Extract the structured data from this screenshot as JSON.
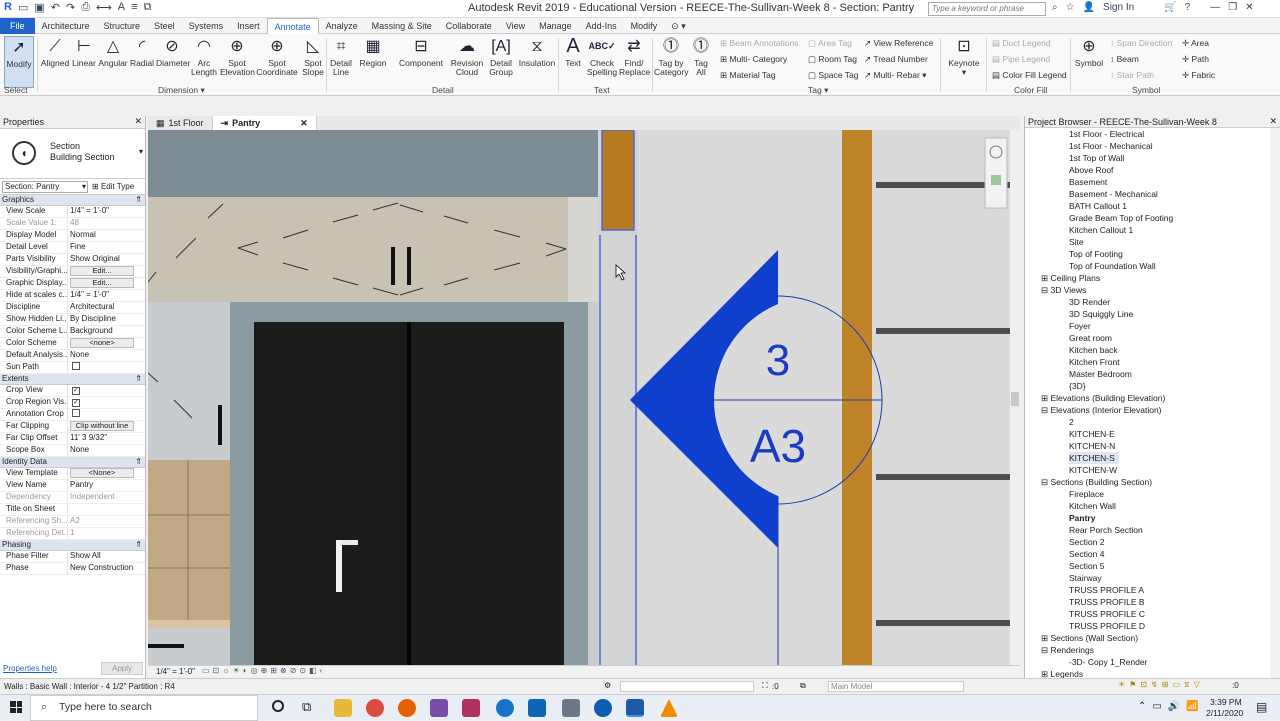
{
  "window": {
    "title": "Autodesk Revit 2019 - Educational Version - REECE-The-Sullivan-Week 8 - Section: Pantry",
    "search_placeholder": "Type a keyword or phrase",
    "sign_in": "Sign In"
  },
  "tabs": [
    "File",
    "Architecture",
    "Structure",
    "Steel",
    "Systems",
    "Insert",
    "Annotate",
    "Analyze",
    "Massing & Site",
    "Collaborate",
    "View",
    "Manage",
    "Add-Ins",
    "Modify"
  ],
  "active_tab": "Annotate",
  "ribbon": {
    "modify": "Modify",
    "select": "Select",
    "dimension_tools": [
      "Aligned",
      "Linear",
      "Angular",
      "Radial",
      "Diameter"
    ],
    "arc_length": [
      "Arc",
      "Length"
    ],
    "spot_elev": [
      "Spot",
      "Elevation"
    ],
    "spot_coord": [
      "Spot",
      "Coordinate"
    ],
    "spot_slope": [
      "Spot",
      "Slope"
    ],
    "dimension_panel": "Dimension",
    "detail_line": [
      "Detail",
      "Line"
    ],
    "region": "Region",
    "component": "Component",
    "revision_cloud": [
      "Revision",
      "Cloud"
    ],
    "detail_group": [
      "Detail",
      "Group"
    ],
    "insulation": "Insulation",
    "detail_panel": "Detail",
    "text": "Text",
    "check_spelling": [
      "Check",
      "Spelling"
    ],
    "find_replace": [
      "Find/",
      "Replace"
    ],
    "text_panel": "Text",
    "tag_by_category": [
      "Tag by",
      "Category"
    ],
    "tag_all": [
      "Tag",
      "All"
    ],
    "beam_annotations": "Beam Annotations",
    "multi_category": "Multi- Category",
    "material_tag": "Material Tag",
    "area_tag": "Area Tag",
    "room_tag": "Room Tag",
    "space_tag": "Space Tag",
    "view_reference": "View Reference",
    "tread_number": "Tread Number",
    "multi_rebar": "Multi- Rebar",
    "tag_panel": "Tag",
    "keynote": "Keynote",
    "duct_legend": "Duct Legend",
    "pipe_legend": "Pipe Legend",
    "color_fill_legend": "Color Fill Legend",
    "color_fill_panel": "Color Fill",
    "symbol": "Symbol",
    "span_direction": "Span Direction",
    "beam": "Beam",
    "stair_path": "Stair Path",
    "area": "Area",
    "path": "Path",
    "fabric": "Fabric",
    "symbol_panel": "Symbol"
  },
  "properties": {
    "header": "Properties",
    "type_line1": "Section",
    "type_line2": "Building Section",
    "instance": "Section: Pantry",
    "edit_type": "Edit Type",
    "sections": [
      {
        "name": "Graphics",
        "rows": [
          [
            "View Scale",
            "1/4\" = 1'-0\"",
            ""
          ],
          [
            "Scale Value    1:",
            "48",
            "dim"
          ],
          [
            "Display Model",
            "Normal",
            ""
          ],
          [
            "Detail Level",
            "Fine",
            ""
          ],
          [
            "Parts Visibility",
            "Show Original",
            ""
          ],
          [
            "Visibility/Graphi...",
            "Edit...",
            "btn"
          ],
          [
            "Graphic Display...",
            "Edit...",
            "btn"
          ],
          [
            "Hide at scales c...",
            "1/4\" = 1'-0\"",
            ""
          ],
          [
            "Discipline",
            "Architectural",
            ""
          ],
          [
            "Show Hidden Li...",
            "By Discipline",
            ""
          ],
          [
            "Color Scheme L...",
            "Background",
            ""
          ],
          [
            "Color Scheme",
            "<none>",
            "btn"
          ],
          [
            "Default Analysis...",
            "None",
            ""
          ],
          [
            "Sun Path",
            "",
            "cb0"
          ]
        ]
      },
      {
        "name": "Extents",
        "rows": [
          [
            "Crop View",
            "",
            "cb1"
          ],
          [
            "Crop Region Vis...",
            "",
            "cb1"
          ],
          [
            "Annotation Crop",
            "",
            "cb0"
          ],
          [
            "Far Clipping",
            "Clip without line",
            "btn"
          ],
          [
            "Far Clip Offset",
            "11' 3 9/32\"",
            ""
          ],
          [
            "Scope Box",
            "None",
            ""
          ]
        ]
      },
      {
        "name": "Identity Data",
        "rows": [
          [
            "View Template",
            "<None>",
            "btn"
          ],
          [
            "View Name",
            "Pantry",
            ""
          ],
          [
            "Dependency",
            "Independent",
            "dim"
          ],
          [
            "Title on Sheet",
            "",
            ""
          ],
          [
            "Referencing Sh...",
            "A2",
            "dim"
          ],
          [
            "Referencing Det...",
            "1",
            "dim"
          ]
        ]
      },
      {
        "name": "Phasing",
        "rows": [
          [
            "Phase Filter",
            "Show All",
            ""
          ],
          [
            "Phase",
            "New Construction",
            ""
          ]
        ]
      }
    ],
    "help": "Properties help",
    "apply": "Apply"
  },
  "view_tabs": [
    {
      "label": "1st Floor",
      "active": false
    },
    {
      "label": "Pantry",
      "active": true
    }
  ],
  "view": {
    "tag_number": "3",
    "tag_sheet": "A3",
    "scale": "1/4\" = 1'-0\""
  },
  "browser": {
    "header": "Project Browser - REECE-The-Sullivan-Week 8",
    "items": [
      {
        "t": "1st Floor - Electrical",
        "l": 3
      },
      {
        "t": "1st Floor - Mechanical",
        "l": 3
      },
      {
        "t": "1st Top of Wall",
        "l": 3
      },
      {
        "t": "Above Roof",
        "l": 3
      },
      {
        "t": "Basement",
        "l": 3
      },
      {
        "t": "Basement - Mechanical",
        "l": 3
      },
      {
        "t": "BATH Callout 1",
        "l": 3
      },
      {
        "t": "Grade Beam Top of Footing",
        "l": 3
      },
      {
        "t": "Kitchen Callout 1",
        "l": 3
      },
      {
        "t": "Site",
        "l": 3
      },
      {
        "t": "Top of Footing",
        "l": 3
      },
      {
        "t": "Top of Foundation Wall",
        "l": 3
      },
      {
        "t": "Ceiling Plans",
        "l": 1,
        "x": "+"
      },
      {
        "t": "3D Views",
        "l": 1,
        "x": "-"
      },
      {
        "t": "3D Render",
        "l": 3
      },
      {
        "t": "3D Squiggly Line",
        "l": 3
      },
      {
        "t": "Foyer",
        "l": 3
      },
      {
        "t": "Great room",
        "l": 3
      },
      {
        "t": "Kitchen back",
        "l": 3
      },
      {
        "t": "Kitchen Front",
        "l": 3
      },
      {
        "t": "Master Bedroom",
        "l": 3
      },
      {
        "t": "{3D}",
        "l": 3
      },
      {
        "t": "Elevations (Building Elevation)",
        "l": 1,
        "x": "+"
      },
      {
        "t": "Elevations (Interior Elevation)",
        "l": 1,
        "x": "-"
      },
      {
        "t": "2",
        "l": 3
      },
      {
        "t": "KITCHEN-E",
        "l": 3
      },
      {
        "t": "KITCHEN-N",
        "l": 3
      },
      {
        "t": "KITCHEN-S",
        "l": 3,
        "s": "sel"
      },
      {
        "t": "KITCHEN-W",
        "l": 3
      },
      {
        "t": "Sections (Building Section)",
        "l": 1,
        "x": "-"
      },
      {
        "t": "Fireplace",
        "l": 3
      },
      {
        "t": "Kitchen Wall",
        "l": 3
      },
      {
        "t": "Pantry",
        "l": 3,
        "s": "bold"
      },
      {
        "t": "Rear Porch Section",
        "l": 3
      },
      {
        "t": "Section 2",
        "l": 3
      },
      {
        "t": "Section 4",
        "l": 3
      },
      {
        "t": "Section 5",
        "l": 3
      },
      {
        "t": "Stairway",
        "l": 3
      },
      {
        "t": "TRUSS PROFILE A",
        "l": 3
      },
      {
        "t": "TRUSS PROFILE B",
        "l": 3
      },
      {
        "t": "TRUSS PROFILE C",
        "l": 3
      },
      {
        "t": "TRUSS PROFILE D",
        "l": 3
      },
      {
        "t": "Sections (Wall Section)",
        "l": 1,
        "x": "+"
      },
      {
        "t": "Renderings",
        "l": 1,
        "x": "-"
      },
      {
        "t": "-3D- Copy 1_Render",
        "l": 3
      },
      {
        "t": "Legends",
        "l": 1,
        "x": "+"
      }
    ]
  },
  "status": {
    "text": "Walls : Basic Wall : Interior - 4 1/2\" Partition : R4",
    "zero": ":0",
    "model": "Main Model"
  },
  "taskbar": {
    "search": "Type here to search",
    "time": "3:39 PM",
    "date": "2/11/2020"
  }
}
